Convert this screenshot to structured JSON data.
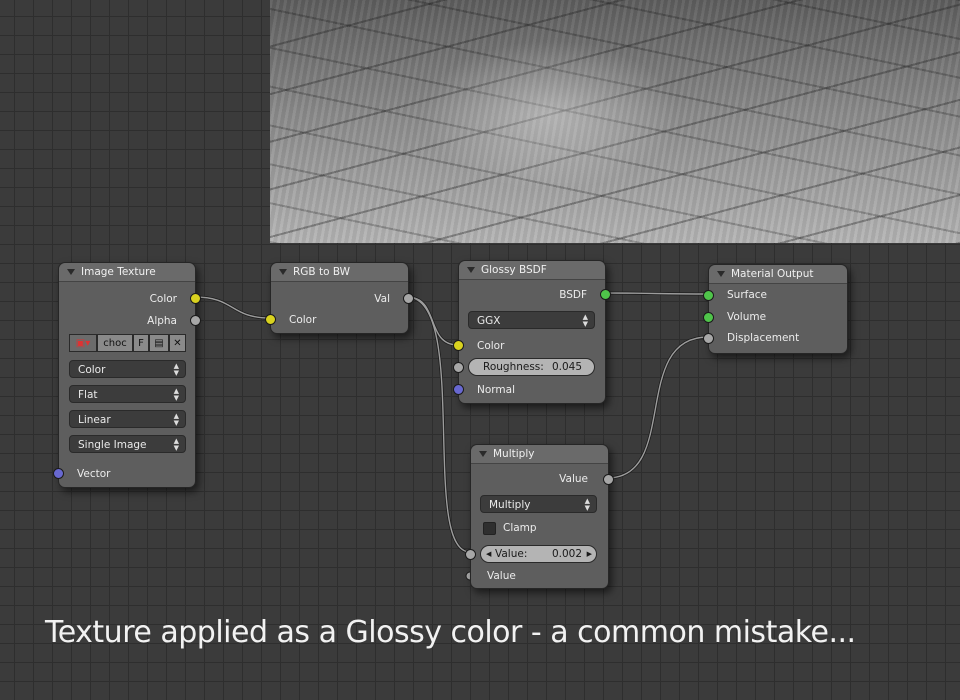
{
  "nodes": {
    "image_texture": {
      "title": "Image Texture",
      "outputs": [
        "Color",
        "Alpha"
      ],
      "image_name": "choc",
      "fake_user": "F",
      "dropdowns": [
        "Color",
        "Flat",
        "Linear",
        "Single Image"
      ],
      "input": "Vector"
    },
    "rgb_to_bw": {
      "title": "RGB to BW",
      "output": "Val",
      "input": "Color"
    },
    "glossy": {
      "title": "Glossy BSDF",
      "output": "BSDF",
      "distribution": "GGX",
      "inputs": {
        "color": "Color",
        "normal": "Normal"
      },
      "roughness_label": "Roughness:",
      "roughness_value": "0.045"
    },
    "material_output": {
      "title": "Material Output",
      "inputs": [
        "Surface",
        "Volume",
        "Displacement"
      ]
    },
    "multiply": {
      "title": "Multiply",
      "output": "Value",
      "operation": "Multiply",
      "clamp_label": "Clamp",
      "value_label": "Value:",
      "value": "0.002",
      "input": "Value"
    }
  },
  "caption": "Texture applied as a Glossy color - a common mistake...",
  "colors": {
    "socket_color": "#d9d21f",
    "socket_float": "#a7a7a7",
    "socket_shader": "#4fc44a",
    "socket_vector": "#6868d0"
  }
}
